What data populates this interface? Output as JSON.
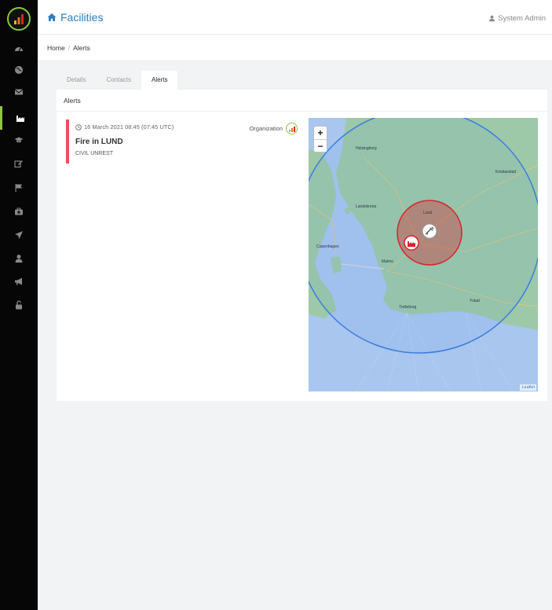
{
  "app": {
    "page_title": "Facilities",
    "user_name": "System Admin"
  },
  "breadcrumb": {
    "home": "Home",
    "separator": "/",
    "current": "Alerts"
  },
  "tabs": [
    {
      "label": "Details",
      "active": false
    },
    {
      "label": "Contacts",
      "active": false
    },
    {
      "label": "Alerts",
      "active": true
    }
  ],
  "card": {
    "title": "Alerts"
  },
  "alert": {
    "time": "16 March 2021 08:45 (07:45 UTC)",
    "title": "Fire in LUND",
    "category": "CIVIL UNREST",
    "organization_label": "Organization",
    "severity_color": "#e84f5f"
  },
  "map": {
    "zoom_in": "+",
    "zoom_out": "−",
    "attribution": "Leaflet",
    "labels": {
      "helsingborg": "Helsingborg",
      "landskrona": "Landskrona",
      "lund": "Lund",
      "copenhagen": "Copenhagen",
      "malmo": "Malmo",
      "trelleborg": "Trelleborg",
      "kristianstad": "Kristianstad",
      "ystad": "Ystad"
    },
    "outer_circle_color": "#3b7de0",
    "inner_circle_color": "#d9232d"
  },
  "sidebar": {
    "icons": [
      "dashboard-icon",
      "globe-icon",
      "envelope-icon",
      "industry-icon",
      "graduation-cap-icon",
      "edit-icon",
      "flag-icon",
      "medkit-icon",
      "plane-icon",
      "user-icon",
      "bullhorn-icon",
      "unlock-icon"
    ]
  },
  "colors": {
    "accent": "#2a7fc3",
    "brand_green": "#8dc63f",
    "sidebar_bg": "#060606"
  }
}
